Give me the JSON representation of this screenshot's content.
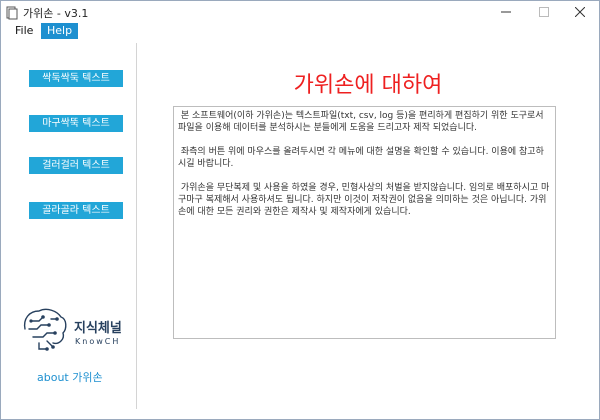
{
  "window": {
    "title": "가위손 - v3.1",
    "app_icon": "document-icon"
  },
  "menu": {
    "items": [
      {
        "label": "File"
      },
      {
        "label": "Help"
      }
    ]
  },
  "sidebar": {
    "buttons": [
      {
        "label": "싹둑싹둑 텍스트"
      },
      {
        "label": "마구싹뚝 텍스트"
      },
      {
        "label": "걸러걸러 텍스트"
      },
      {
        "label": "골라골라 텍스트"
      }
    ],
    "logo": {
      "name": "지식체널",
      "sub": "KnowCH"
    },
    "about_link": "about 가위손"
  },
  "main": {
    "title": "가위손에 대하여",
    "paragraphs": [
      " 본 소프트웨어(이하 가위손)는 텍스트파일(txt, csv, log 등)을 편리하게 편집하기 위한 도구로서 파일을 이용해 데이터를 분석하시는 분들에게 도움을 드리고자 제작 되었습니다.",
      " 좌측의 버튼 위에 마우스를 올려두시면 각 메뉴에 대한 설명을 확인할 수 있습니다. 이용에 참고하시길 바랍니다.",
      " 가위손을 무단복제 및 사용을 하였을 경우, 민형사상의 처벌을 받지않습니다. 임의로 배포하시고 마구마구 복제해서 사용하셔도 됩니다. 하지만 이것이 저작권이 없음을 의미하는 것은 아닙니다. 가위손에 대한 모든 권리와 권한은 제작사 및 제작자에게 있습니다."
    ]
  },
  "colors": {
    "accent": "#22a6d8",
    "title_red": "#ee2020",
    "logo_navy": "#27405e"
  }
}
